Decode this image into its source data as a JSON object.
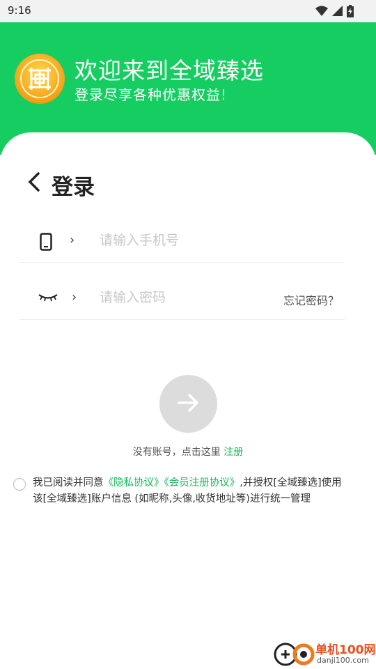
{
  "status_bar": {
    "time": "9:16"
  },
  "header": {
    "title": "欢迎来到全域臻选",
    "subtitle": "登录尽享各种优惠权益!"
  },
  "login": {
    "title": "登录",
    "phone_placeholder": "请输入手机号",
    "password_placeholder": "请输入密码",
    "forgot": "忘记密码？",
    "no_account_text": "没有账号，点击这里 ",
    "register_link": "注册"
  },
  "agreement": {
    "prefix": "我已阅读并同意",
    "privacy": "《隐私协议》",
    "member": "《会员注册协议》",
    "suffix": ",并授权[全域臻选]使用该[全域臻选]账户信息 (如昵称,头像,收货地址等)进行统一管理"
  },
  "watermark": {
    "line1": "单机100网",
    "line2": "danji100.com"
  },
  "colors": {
    "brand": "#16cd62",
    "link": "#16b85a",
    "button_disabled": "#dcdcdc"
  },
  "icons": [
    "wifi-icon",
    "signal-icon",
    "battery-icon",
    "back-icon",
    "phone-icon",
    "eye-closed-icon",
    "chevron-right-icon",
    "arrow-right-icon"
  ]
}
